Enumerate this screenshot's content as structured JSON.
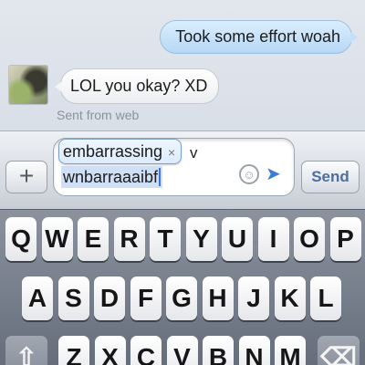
{
  "conversation": {
    "messages": [
      {
        "direction": "outgoing",
        "text": "Took some effort woah"
      },
      {
        "direction": "incoming",
        "text": "LOL you okay? XD",
        "meta": "Sent from web"
      }
    ]
  },
  "composer": {
    "add_label": "+",
    "line1_tail": "v",
    "line2_text": "wnbarraaaibf",
    "autocorrect_suggestion": "embarrassing",
    "autocorrect_dismiss": "×",
    "emoji_icon": "smiley-icon",
    "location_icon": "location-arrow-icon",
    "send_label": "Send"
  },
  "keyboard": {
    "row1": [
      "Q",
      "W",
      "E",
      "R",
      "T",
      "Y",
      "U",
      "I",
      "O",
      "P"
    ],
    "row2": [
      "A",
      "S",
      "D",
      "F",
      "G",
      "H",
      "J",
      "K",
      "L"
    ],
    "row3": [
      "Z",
      "X",
      "C",
      "V",
      "B",
      "N",
      "M"
    ],
    "shift_icon": "⇧",
    "delete_icon": "⌫"
  }
}
